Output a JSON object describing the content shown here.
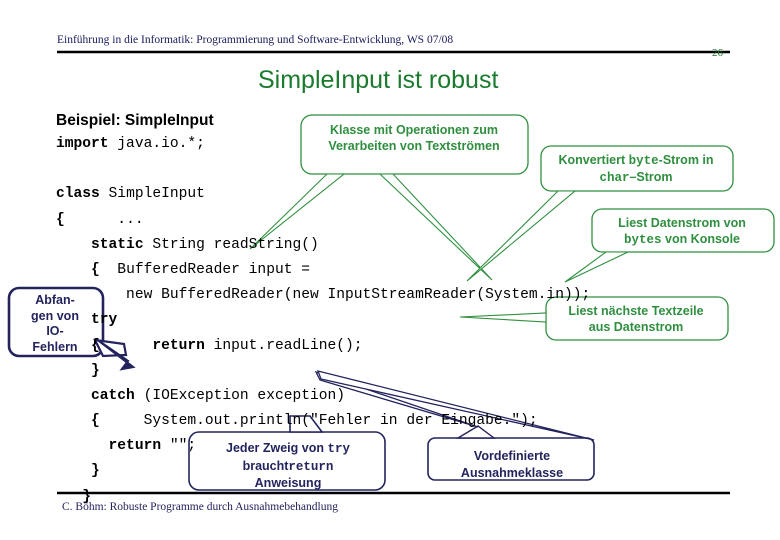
{
  "slide": {
    "header": "Einführung in die Informatik: Programmierung und Software-Entwicklung, WS 07/08",
    "page_number": "26",
    "title": "SimpleInput ist robust",
    "example_caption": "Beispiel: SimpleInput",
    "footer": "C. Böhm: Robuste Programme durch Ausnahmebehandlung"
  },
  "colors": {
    "green": "#2f8f3f",
    "title_green": "#1a7a2e",
    "blue": "#23235e",
    "rule": "#000000",
    "code": "#000000"
  },
  "code": {
    "lines": [
      [
        {
          "t": "import",
          "b": true
        },
        {
          "t": " java.io.*;",
          "b": false
        }
      ],
      [
        {
          "t": "",
          "b": false
        }
      ],
      [
        {
          "t": "class",
          "b": true
        },
        {
          "t": " SimpleInput",
          "b": false
        }
      ],
      [
        {
          "t": "{",
          "b": true
        },
        {
          "t": "      ...",
          "b": false
        }
      ],
      [
        {
          "t": "    ",
          "b": false
        },
        {
          "t": "static",
          "b": true
        },
        {
          "t": " String readString()",
          "b": false
        }
      ],
      [
        {
          "t": "    ",
          "b": false
        },
        {
          "t": "{",
          "b": true
        },
        {
          "t": "  BufferedReader input =",
          "b": false
        }
      ],
      [
        {
          "t": "        new BufferedReader(new InputStreamReader(System.in));",
          "b": false
        }
      ],
      [
        {
          "t": "    ",
          "b": false
        },
        {
          "t": "try",
          "b": true
        }
      ],
      [
        {
          "t": "    ",
          "b": false
        },
        {
          "t": "{",
          "b": true
        },
        {
          "t": "      ",
          "b": false
        },
        {
          "t": "return",
          "b": true
        },
        {
          "t": " input.readLine();",
          "b": false
        }
      ],
      [
        {
          "t": "    ",
          "b": false
        },
        {
          "t": "}",
          "b": true
        }
      ],
      [
        {
          "t": "    ",
          "b": false
        },
        {
          "t": "catch",
          "b": true
        },
        {
          "t": " (IOException exception)",
          "b": false
        }
      ],
      [
        {
          "t": "    ",
          "b": false
        },
        {
          "t": "{",
          "b": true
        },
        {
          "t": "     System.out.println(\"Fehler in der Eingabe.\");",
          "b": false
        }
      ],
      [
        {
          "t": "      ",
          "b": false
        },
        {
          "t": "return",
          "b": true
        },
        {
          "t": " \"\";",
          "b": false
        }
      ],
      [
        {
          "t": "    ",
          "b": false
        },
        {
          "t": "}",
          "b": true
        }
      ],
      [
        {
          "t": "   ",
          "b": false
        },
        {
          "t": "}",
          "b": true
        }
      ]
    ]
  },
  "callouts": [
    {
      "id": "klasse",
      "color": "green",
      "lines": [
        [
          {
            "t": "Klasse mit Operationen zum",
            "m": false
          }
        ],
        [
          {
            "t": "Verarbeiten von  Textströmen",
            "m": false
          }
        ]
      ]
    },
    {
      "id": "konvertiert",
      "color": "green",
      "lines": [
        [
          {
            "t": "Konvertiert ",
            "m": false
          },
          {
            "t": "byte",
            "m": true
          },
          {
            "t": "-Strom in",
            "m": false
          }
        ],
        [
          {
            "t": "char",
            "m": true
          },
          {
            "t": "–",
            "m": false
          },
          {
            "t": "Strom",
            "m": false
          }
        ]
      ]
    },
    {
      "id": "liest-bytes",
      "color": "green",
      "lines": [
        [
          {
            "t": "Liest Datenstrom von",
            "m": false
          }
        ],
        [
          {
            "t": "bytes",
            "m": true
          },
          {
            "t": "  von Konsole",
            "m": false
          }
        ]
      ]
    },
    {
      "id": "liest-zeile",
      "color": "green",
      "lines": [
        [
          {
            "t": "Liest nächste Textzeile",
            "m": false
          }
        ],
        [
          {
            "t": "aus Datenstrom",
            "m": false
          }
        ]
      ]
    },
    {
      "id": "abfangen",
      "color": "blue",
      "lines": [
        [
          {
            "t": "Abfan-",
            "m": false
          }
        ],
        [
          {
            "t": "gen von",
            "m": false
          }
        ],
        [
          {
            "t": "IO-",
            "m": false
          }
        ],
        [
          {
            "t": "Fehlern",
            "m": false
          }
        ]
      ]
    },
    {
      "id": "jeder-zweig",
      "color": "blue",
      "lines": [
        [
          {
            "t": "Jeder Zweig von ",
            "m": false
          },
          {
            "t": "try",
            "m": true
          }
        ],
        [
          {
            "t": "braucht",
            "m": false
          },
          {
            "t": "return",
            "m": true
          }
        ],
        [
          {
            "t": "Anweisung",
            "m": false
          }
        ]
      ]
    },
    {
      "id": "vordefiniert",
      "color": "blue",
      "lines": [
        [
          {
            "t": "Vordefinierte",
            "m": false
          }
        ],
        [
          {
            "t": "Ausnahmeklasse",
            "m": false
          }
        ]
      ]
    }
  ]
}
